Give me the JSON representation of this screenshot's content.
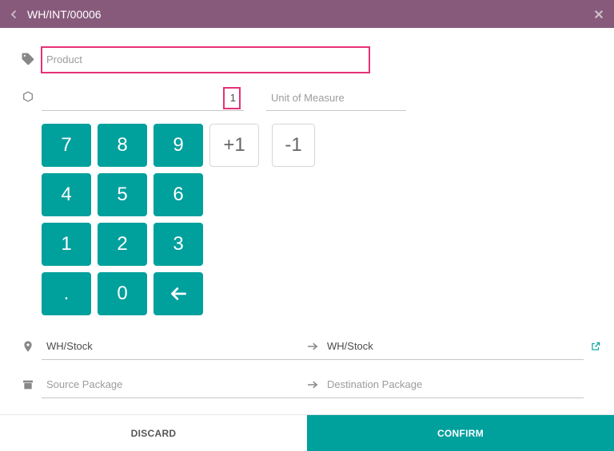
{
  "header": {
    "title": "WH/INT/00006"
  },
  "product": {
    "placeholder": "Product",
    "value": ""
  },
  "quantity": {
    "value": "1"
  },
  "uom": {
    "placeholder": "Unit of Measure",
    "value": ""
  },
  "keypad": {
    "k7": "7",
    "k8": "8",
    "k9": "9",
    "plus1": "+1",
    "minus1": "-1",
    "k4": "4",
    "k5": "5",
    "k6": "6",
    "k1": "1",
    "k2": "2",
    "k3": "3",
    "dot": ".",
    "k0": "0"
  },
  "location": {
    "source": "WH/Stock",
    "destination": "WH/Stock"
  },
  "package": {
    "source_placeholder": "Source Package",
    "destination_placeholder": "Destination Package"
  },
  "footer": {
    "discard": "DISCARD",
    "confirm": "CONFIRM"
  }
}
